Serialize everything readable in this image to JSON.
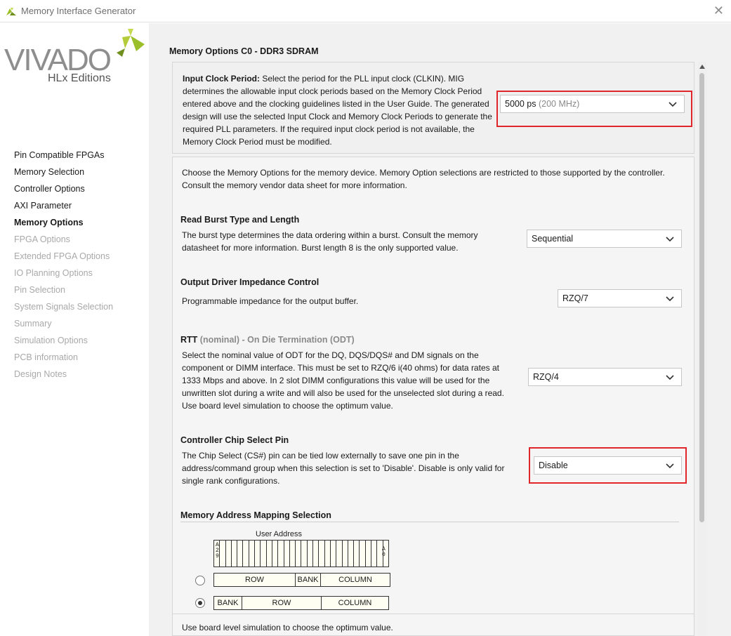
{
  "window": {
    "title": "Memory Interface Generator",
    "close_icon": "close-icon"
  },
  "logo": {
    "wordmark": "VIVADO",
    "edition": "HLx Editions"
  },
  "nav": [
    {
      "label": "Pin Compatible FPGAs",
      "state": "enabled"
    },
    {
      "label": "Memory Selection",
      "state": "enabled"
    },
    {
      "label": "Controller Options",
      "state": "enabled"
    },
    {
      "label": "AXI Parameter",
      "state": "enabled"
    },
    {
      "label": "Memory Options",
      "state": "active"
    },
    {
      "label": "FPGA Options",
      "state": "disabled"
    },
    {
      "label": "Extended FPGA Options",
      "state": "disabled"
    },
    {
      "label": "IO Planning Options",
      "state": "disabled"
    },
    {
      "label": "Pin Selection",
      "state": "disabled"
    },
    {
      "label": "System Signals Selection",
      "state": "disabled"
    },
    {
      "label": "Summary",
      "state": "disabled"
    },
    {
      "label": "Simulation Options",
      "state": "disabled"
    },
    {
      "label": "PCB information",
      "state": "disabled"
    },
    {
      "label": "Design Notes",
      "state": "disabled"
    }
  ],
  "main": {
    "title": "Memory Options C0 - DDR3 SDRAM",
    "input_clock": {
      "label": "Input Clock Period:",
      "description": " Select the period for the PLL input clock (CLKIN). MIG determines the allowable input clock periods based on the Memory Clock Period entered above and the clocking guidelines listed in the User Guide. The generated design will use the selected Input Clock and Memory Clock Periods to generate the required PLL parameters. If the required input clock period is not available, the Memory Clock Period must be modified.",
      "value": "5000 ps",
      "value_hint": "(200 MHz)"
    },
    "intro": "Choose the Memory Options for the memory device. Memory Option selections are restricted to those supported by the controller. Consult the memory vendor data sheet for more information.",
    "burst": {
      "title": "Read Burst Type and Length",
      "description": "The burst type determines the data ordering within a burst. Consult the memory datasheet for more information. Burst length 8 is the only supported value.",
      "value": "Sequential"
    },
    "odi": {
      "title": "Output Driver Impedance Control",
      "description": "Programmable impedance for the output buffer.",
      "value": "RZQ/7"
    },
    "rtt": {
      "title": "RTT",
      "title_suffix": " (nominal) - On Die Termination (ODT)",
      "description": "Select the nominal value of ODT for the DQ, DQS/DQS# and DM signals on the component or DIMM interface. This must be set to RZQ/6 i(40 ohms) for data rates at 1333 Mbps and above. In 2 slot DIMM configurations this value will be used for the unwritten slot during a write and will also be used for the unselected slot during a read. Use board level simulation to choose the optimum value.",
      "value": "RZQ/4"
    },
    "cs": {
      "title": "Controller Chip Select Pin",
      "description": "The Chip Select (CS#) pin can be tied low externally to save one pin in the address/command group when this selection is set to 'Disable'. Disable is only valid for single rank configurations.",
      "value": "Disable"
    },
    "mapping": {
      "title": "Memory Address Mapping Selection",
      "user_address": "User Address",
      "msb_label": "A29",
      "lsb_label": "A0",
      "option1": [
        "ROW",
        "BANK",
        "COLUMN"
      ],
      "option2": [
        "BANK",
        "ROW",
        "COLUMN"
      ],
      "selected": 2
    },
    "footer_note": "Use board level simulation to choose the optimum value."
  },
  "colors": {
    "highlight": "#e0252b",
    "logo_green": "#9bbf2a"
  }
}
